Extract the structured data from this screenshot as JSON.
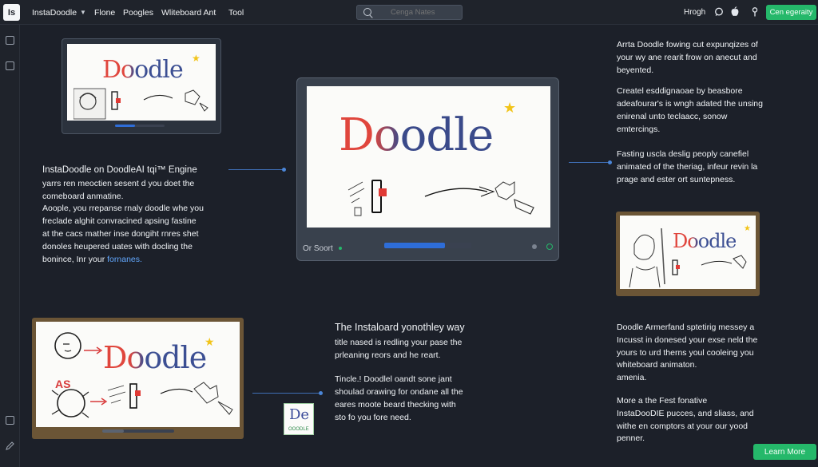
{
  "topbar": {
    "logo": "Is",
    "nav": [
      {
        "label": "InstaDoodle",
        "caret": true
      },
      {
        "label": "Flone"
      },
      {
        "label": "Poogles"
      },
      {
        "label": "Wliteboard Ant"
      },
      {
        "label": "Tool"
      }
    ],
    "search_placeholder": "Cenga Nates",
    "right_label": "Hrogh",
    "cta": "Cen egeraity"
  },
  "center_player": {
    "doodle_word": "Doodle",
    "status_label": "Or Soort",
    "progress": 0.7
  },
  "panels": {
    "top_left": {
      "doodle_word": "Doodle"
    },
    "bottom_left": {
      "doodle_word": "Doodle",
      "as_label": "AS"
    },
    "right": {
      "doodle_word": "Doodle"
    }
  },
  "badge": {
    "big": "De",
    "small": "OOODLE"
  },
  "left_block": {
    "heading": "InstaDoodle on DoodleAI tqi™ Engine",
    "lines": [
      "yarrs ren meoctien sesent d you doet the",
      "comeboard anmatine.",
      "Aoople, you rrepanse rnaly doodle whe you",
      "freclade alghit convracined apsing fastine",
      "at the cacs mather inse dongiht rnres shet",
      "donoles heupered uates with docling the"
    ],
    "last_line_prefix": "bonince, Inr your ",
    "last_line_link": "fornanes."
  },
  "right_top_block": {
    "para1": [
      "Arrta Doodle fowing cut expunqizes of",
      "your wy ane rearit frow on anecut and",
      "beyented."
    ],
    "para2": [
      "Createl esddignaoae by beasbore",
      "adeafourar's is wngh adated the unsing",
      "enirenal unto teclaacc, sonow",
      "emtercings."
    ]
  },
  "right_mid_block": {
    "lines": [
      "Fasting uscla deslig peoply canefiel",
      "animated of the theriag, infeur revin la",
      "prage and ester ort suntepness."
    ]
  },
  "bottom_mid_block": {
    "heading": "The Instaloard yonothley way",
    "para1": [
      "title nased is redling your pase the",
      "prleaning reors and he reart."
    ],
    "para2": [
      "Tincle.! Doodlel oandt sone jant",
      "shoulad orawing for ondane all the",
      "eares moote beard thecking with",
      "sto fo you fore need."
    ]
  },
  "bottom_right_block": {
    "para1": [
      "Doodle Armerfand sptetirig messey a",
      "Incusst in donesed your exse neld the",
      "yours to urd therns youl cooleing you",
      "whiteboard animaton.",
      "amenia."
    ],
    "para2": [
      "More a the Fest fonative",
      "InstaDooDIE pucces, and sliass, and",
      "withe en comptors at your our yood",
      "penner."
    ]
  },
  "learn_more": "Learn More",
  "colors": {
    "background": "#1c2029",
    "accent_green": "#25b86a",
    "progress_blue": "#2e6dd8",
    "frame_brown": "#6b5536",
    "link_blue": "#62a8ff"
  },
  "icons": [
    "search-icon",
    "chat-icon",
    "apple-icon",
    "pin-icon",
    "grid-icon",
    "list-icon",
    "chevron-down-icon",
    "star-icon"
  ]
}
